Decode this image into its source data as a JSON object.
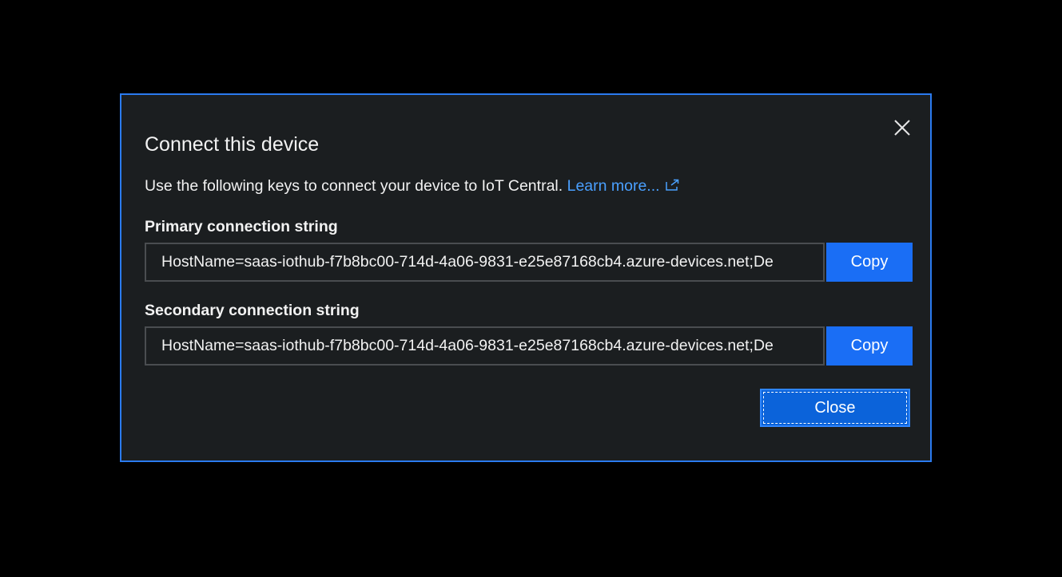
{
  "dialog": {
    "title": "Connect this device",
    "description": "Use the following keys to connect your device to IoT Central.",
    "learn_more_label": "Learn more...",
    "close_icon": "close-icon",
    "external_link_icon": "external-link-icon",
    "primary": {
      "label": "Primary connection string",
      "value": "HostName=saas-iothub-f7b8bc00-714d-4a06-9831-e25e87168cb4.azure-devices.net;De",
      "copy_label": "Copy"
    },
    "secondary": {
      "label": "Secondary connection string",
      "value": "HostName=saas-iothub-f7b8bc00-714d-4a06-9831-e25e87168cb4.azure-devices.net;De",
      "copy_label": "Copy"
    },
    "close_label": "Close"
  },
  "colors": {
    "background": "#000000",
    "dialog_bg": "#1b1e20",
    "dialog_border": "#2b7bf0",
    "accent": "#1a6ef5",
    "link": "#4aa0ff"
  }
}
